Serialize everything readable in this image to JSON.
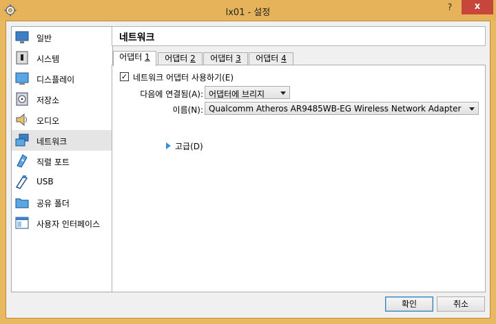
{
  "window": {
    "title": "lx01 - 설정",
    "help": "?",
    "close": "x"
  },
  "sidebar": {
    "items": [
      {
        "label": "일반",
        "icon": "monitor-general-icon"
      },
      {
        "label": "시스템",
        "icon": "chip-system-icon"
      },
      {
        "label": "디스플레이",
        "icon": "display-monitor-icon"
      },
      {
        "label": "저장소",
        "icon": "storage-disk-icon"
      },
      {
        "label": "오디오",
        "icon": "speaker-audio-icon"
      },
      {
        "label": "네트워크",
        "icon": "network-icon",
        "selected": true
      },
      {
        "label": "직렬 포트",
        "icon": "serial-port-icon"
      },
      {
        "label": "USB",
        "icon": "usb-icon"
      },
      {
        "label": "공유 폴더",
        "icon": "shared-folder-icon"
      },
      {
        "label": "사용자 인터페이스",
        "icon": "user-interface-icon"
      }
    ]
  },
  "page": {
    "title": "네트워크"
  },
  "tabs": [
    {
      "prefix": "어댑터 ",
      "num": "1",
      "active": true
    },
    {
      "prefix": "어댑터 ",
      "num": "2"
    },
    {
      "prefix": "어댑터 ",
      "num": "3"
    },
    {
      "prefix": "어댑터 ",
      "num": "4"
    }
  ],
  "adapter": {
    "enable_label": "네트워크 어댑터 사용하기(E)",
    "enable_checked": true,
    "check_mark": "✓",
    "attached_label": "다음에 연결됨(A):",
    "attached_value": "어댑터에 브리지",
    "name_label": "이름(N):",
    "name_value": "Qualcomm Atheros AR9485WB-EG Wireless Network Adapter",
    "advanced_label": "고급(D)"
  },
  "buttons": {
    "ok": "확인",
    "cancel": "취소"
  },
  "colors": {
    "titlebar": "#e6b35a",
    "close": "#c7463b",
    "expand_arrow": "#3a8fd8"
  }
}
